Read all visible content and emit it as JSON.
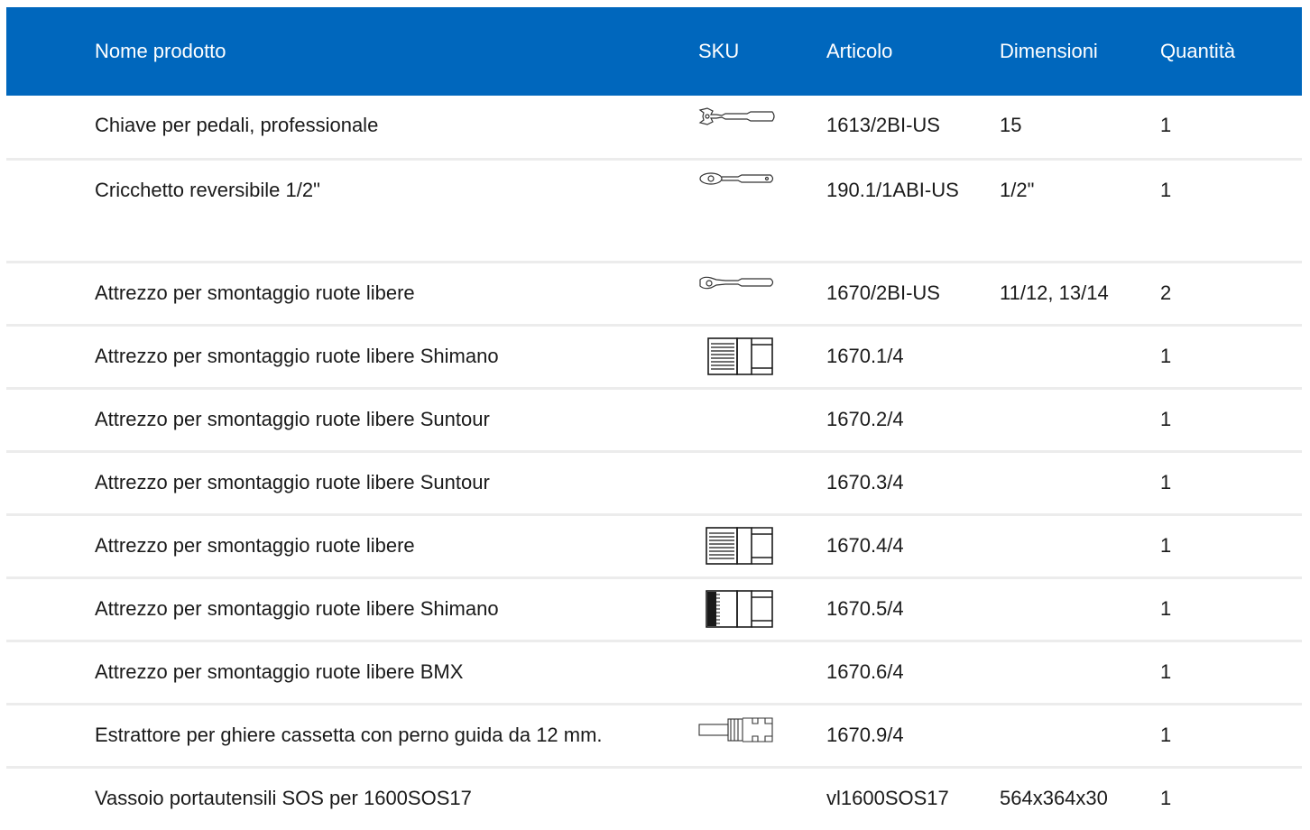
{
  "header": {
    "name": "Nome prodotto",
    "sku": "SKU",
    "article": "Articolo",
    "dimensions": "Dimensioni",
    "quantity": "Quantità"
  },
  "rows": [
    {
      "name": "Chiave per pedali, professionale",
      "sku_icon": "pedal-wrench-icon",
      "article": "1613/2BI-US",
      "dimensions": "15",
      "quantity": "1"
    },
    {
      "name": "Cricchetto reversibile 1/2\"",
      "sku_icon": "ratchet-icon",
      "article": "190.1/1ABI-US",
      "dimensions": "1/2\"",
      "quantity": "1"
    },
    {
      "name": "Attrezzo per smontaggio ruote libere",
      "sku_icon": "ratchet-handle-icon",
      "article": "1670/2BI-US",
      "dimensions": "11/12, 13/14",
      "quantity": "2"
    },
    {
      "name": "Attrezzo per smontaggio ruote libere Shimano",
      "sku_icon": "freewheel-socket-icon",
      "article": "1670.1/4",
      "dimensions": "",
      "quantity": "1"
    },
    {
      "name": "Attrezzo per smontaggio ruote libere Suntour",
      "sku_icon": "",
      "article": "1670.2/4",
      "dimensions": "",
      "quantity": "1"
    },
    {
      "name": "Attrezzo per smontaggio ruote libere Suntour",
      "sku_icon": "",
      "article": "1670.3/4",
      "dimensions": "",
      "quantity": "1"
    },
    {
      "name": "Attrezzo per smontaggio ruote libere",
      "sku_icon": "freewheel-socket-icon",
      "article": "1670.4/4",
      "dimensions": "",
      "quantity": "1"
    },
    {
      "name": "Attrezzo per smontaggio ruote libere Shimano",
      "sku_icon": "freewheel-socket-dense-icon",
      "article": "1670.5/4",
      "dimensions": "",
      "quantity": "1"
    },
    {
      "name": "Attrezzo per smontaggio ruote libere BMX",
      "sku_icon": "",
      "article": "1670.6/4",
      "dimensions": "",
      "quantity": "1"
    },
    {
      "name": "Estrattore per ghiere cassetta con perno guida da 12 mm.",
      "sku_icon": "cassette-lockring-tool-icon",
      "article": "1670.9/4",
      "dimensions": "",
      "quantity": "1"
    },
    {
      "name": "Vassoio portautensili SOS per 1600SOS17",
      "sku_icon": "",
      "article": "vl1600SOS17",
      "dimensions": "564x364x30",
      "quantity": "1"
    }
  ],
  "colors": {
    "header_bg": "#0067bd",
    "header_text": "#ffffff",
    "row_divider": "#ececec"
  }
}
